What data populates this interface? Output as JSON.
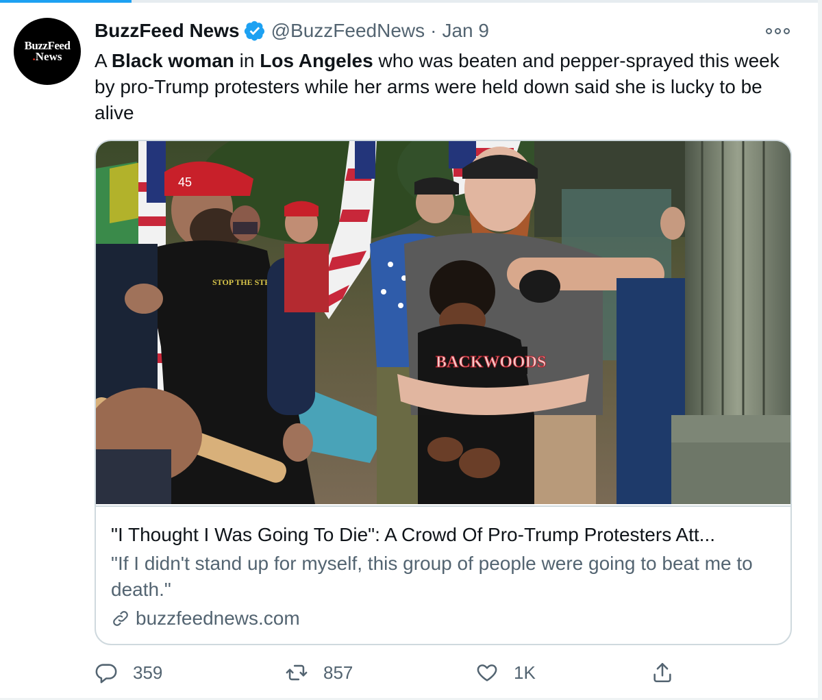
{
  "tweet": {
    "author_name": "BuzzFeed News",
    "handle": "@BuzzFeedNews",
    "separator": "·",
    "date": "Jan 9",
    "avatar": {
      "line1": "BuzzFeed",
      "line2_dot": ".",
      "line2": "News"
    },
    "text_segments": [
      {
        "text": "A ",
        "bold": false
      },
      {
        "text": "Black woman",
        "bold": true
      },
      {
        "text": " in ",
        "bold": false
      },
      {
        "text": "Los Angeles",
        "bold": true
      },
      {
        "text": " who was beaten and pepper-sprayed this week by pro-Trump protesters while her arms were held down said she is lucky to be alive",
        "bold": false
      }
    ]
  },
  "card": {
    "title": "\"I Thought I Was Going To Die\": A Crowd Of Pro-Trump Protesters Att...",
    "description": "\"If I didn't stand up for myself, this group of people were going to beat me to death.\"",
    "domain": "buzzfeednews.com",
    "image_texts": {
      "hat": "45",
      "shirt": "STOP THE STEAL",
      "hoodie": "BACKWOODS"
    }
  },
  "actions": {
    "reply_count": "359",
    "retweet_count": "857",
    "like_count": "1K"
  },
  "colors": {
    "accent": "#1da1f2",
    "text_primary": "#0f1419",
    "text_secondary": "#536471",
    "border": "#cfd9de"
  },
  "icons": [
    "verified-badge-icon",
    "more-icon",
    "link-icon",
    "reply-icon",
    "retweet-icon",
    "like-icon",
    "share-icon"
  ]
}
